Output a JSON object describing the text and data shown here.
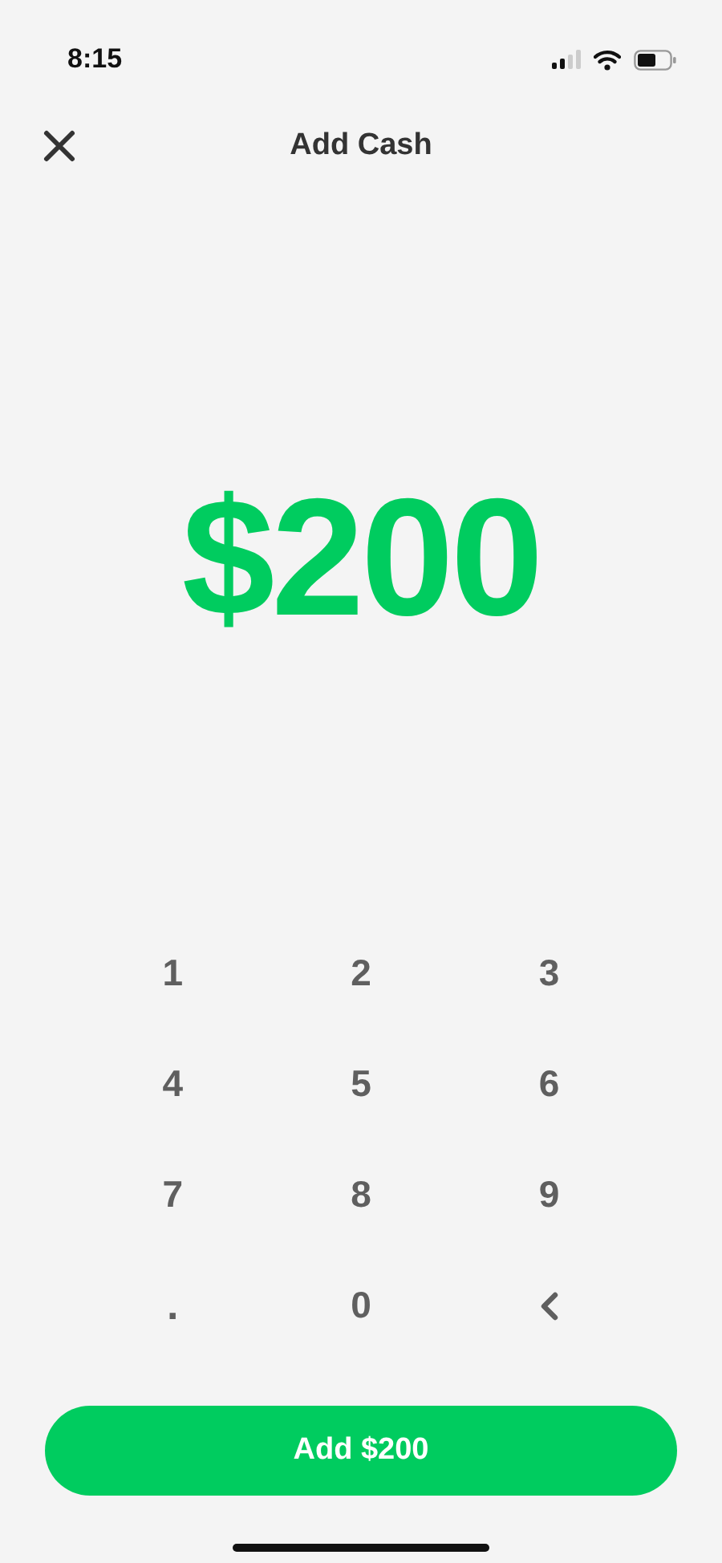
{
  "status_bar": {
    "time": "8:15"
  },
  "header": {
    "title": "Add Cash"
  },
  "amount": "$200",
  "keypad": [
    {
      "kind": "digit",
      "label": "1"
    },
    {
      "kind": "digit",
      "label": "2"
    },
    {
      "kind": "digit",
      "label": "3"
    },
    {
      "kind": "digit",
      "label": "4"
    },
    {
      "kind": "digit",
      "label": "5"
    },
    {
      "kind": "digit",
      "label": "6"
    },
    {
      "kind": "digit",
      "label": "7"
    },
    {
      "kind": "digit",
      "label": "8"
    },
    {
      "kind": "digit",
      "label": "9"
    },
    {
      "kind": "dot",
      "label": "."
    },
    {
      "kind": "digit",
      "label": "0"
    },
    {
      "kind": "backspace"
    }
  ],
  "primary_button": {
    "label": "Add $200"
  }
}
